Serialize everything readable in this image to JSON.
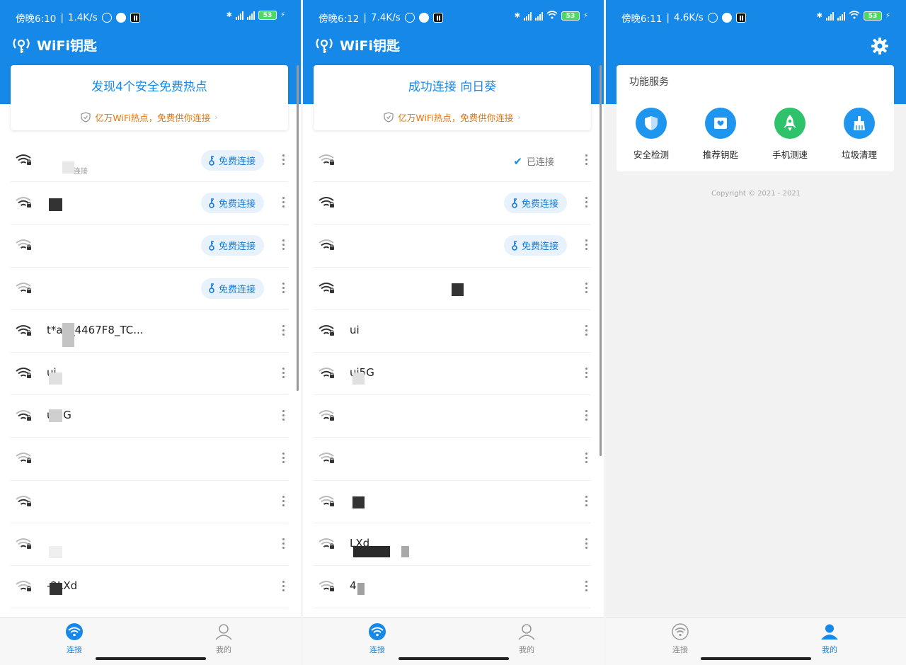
{
  "status_bars": [
    {
      "time": "傍晚6:10",
      "speed": "1.4K/s",
      "battery": "53"
    },
    {
      "time": "傍晚6:12",
      "speed": "7.4K/s",
      "battery": "53"
    },
    {
      "time": "傍晚6:11",
      "speed": "4.6K/s",
      "battery": "53"
    }
  ],
  "app_title": "WiFi钥匙",
  "screen1": {
    "card_title": "发现4个安全免费热点",
    "card_sub": "亿万WiFi热点，免费供你连接",
    "rows": [
      {
        "name": "",
        "sub": "连接",
        "action": "免费连接"
      },
      {
        "name": "",
        "sub": "",
        "action": "免费连接"
      },
      {
        "name": "",
        "sub": "",
        "action": "免费连接"
      },
      {
        "name": "",
        "sub": "",
        "action": "免费连接"
      },
      {
        "name": "t*ap_4467F8_TC...",
        "sub": "",
        "action": ""
      },
      {
        "name": "ui",
        "sub": "",
        "action": ""
      },
      {
        "name": "ui5G",
        "sub": "",
        "action": ""
      },
      {
        "name": "",
        "sub": "",
        "action": ""
      },
      {
        "name": "",
        "sub": "",
        "action": ""
      },
      {
        "name": "",
        "sub": "",
        "action": ""
      },
      {
        "name": "-2LXd",
        "sub": "",
        "action": ""
      }
    ]
  },
  "screen2": {
    "card_title": "成功连接 向日葵",
    "card_sub": "亿万WiFi热点，免费供你连接",
    "rows": [
      {
        "name": "",
        "action": "",
        "status": "已连接"
      },
      {
        "name": "",
        "action": "免费连接",
        "status": ""
      },
      {
        "name": "",
        "action": "免费连接",
        "status": ""
      },
      {
        "name": "",
        "action": "",
        "status": ""
      },
      {
        "name": "ui",
        "action": "",
        "status": ""
      },
      {
        "name": "ui5G",
        "action": "",
        "status": ""
      },
      {
        "name": "",
        "action": "",
        "status": ""
      },
      {
        "name": "",
        "action": "",
        "status": ""
      },
      {
        "name": "",
        "action": "",
        "status": ""
      },
      {
        "name": "LXd",
        "action": "",
        "status": ""
      },
      {
        "name": "4",
        "action": "",
        "status": ""
      }
    ]
  },
  "screen3": {
    "section_title": "功能服务",
    "services": [
      {
        "label": "安全检测",
        "icon": "shield-icon",
        "color": "#1e96f0"
      },
      {
        "label": "推荐钥匙",
        "icon": "key-card-icon",
        "color": "#1e96f0"
      },
      {
        "label": "手机测速",
        "icon": "rocket-icon",
        "color": "#2ec26a"
      },
      {
        "label": "垃圾清理",
        "icon": "broom-icon",
        "color": "#1e96f0"
      }
    ],
    "copyright": "Copyright © 2021 - 2021"
  },
  "nav": {
    "connect": "连接",
    "mine": "我的"
  },
  "colors": {
    "brand": "#1588e8",
    "warning_text": "#e8740c",
    "speed_green": "#2ec26a"
  }
}
